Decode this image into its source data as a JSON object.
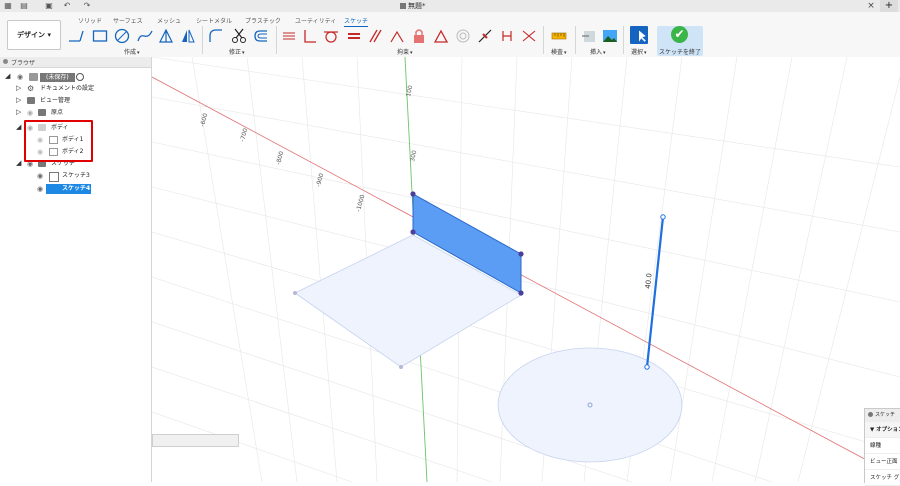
{
  "titlebar": {
    "document_title": "無題*",
    "icons": [
      "grid-menu-icon",
      "file-icon",
      "save-icon",
      "undo-icon",
      "redo-icon"
    ],
    "close_symbol": "×",
    "new_tab_symbol": "+"
  },
  "workspace": {
    "label": "デザイン",
    "caret": "▾"
  },
  "tabs": [
    "ソリッド",
    "サーフェス",
    "メッシュ",
    "シートメタル",
    "プラスチック",
    "ユーティリティ",
    "スケッチ"
  ],
  "active_tab": "スケッチ",
  "ribbon_groups": {
    "create": "作成",
    "modify": "修正",
    "constraints": "拘束",
    "inspect": "検査",
    "insert": "挿入",
    "select": "選択",
    "finish": "スケッチを終了"
  },
  "caret": "▾",
  "browser": {
    "title": "ブラウザ",
    "root_label": "(未保存)",
    "items": [
      {
        "label": "ドキュメントの設定"
      },
      {
        "label": "ビュー管理"
      },
      {
        "label": "原点"
      },
      {
        "label": "ボディ"
      },
      {
        "label": "ボディ1"
      },
      {
        "label": "ボディ2"
      },
      {
        "label": "スケッチ"
      },
      {
        "label": "スケッチ3"
      },
      {
        "label": "スケッチ4",
        "selected": true
      }
    ]
  },
  "viewport": {
    "dimension_labels": [
      "100",
      "300",
      "400",
      "500",
      "-600",
      "-700",
      "-800",
      "-900",
      "-1000"
    ],
    "line_dimension_label": "40.0"
  },
  "sketch_palette": {
    "title": "スケッチ パ",
    "options_header": "▼ オプション",
    "rows": [
      "線種",
      "ビュー正面",
      "スケッチ グリッ"
    ]
  },
  "colors": {
    "accent": "#0a66c2",
    "selection": "#1e88e5",
    "profile_fill": "#5b9df5",
    "x_axis": "#e06060",
    "y_axis": "#4caf50",
    "highlight": "#e00000",
    "finish_green": "#3bb54a"
  }
}
